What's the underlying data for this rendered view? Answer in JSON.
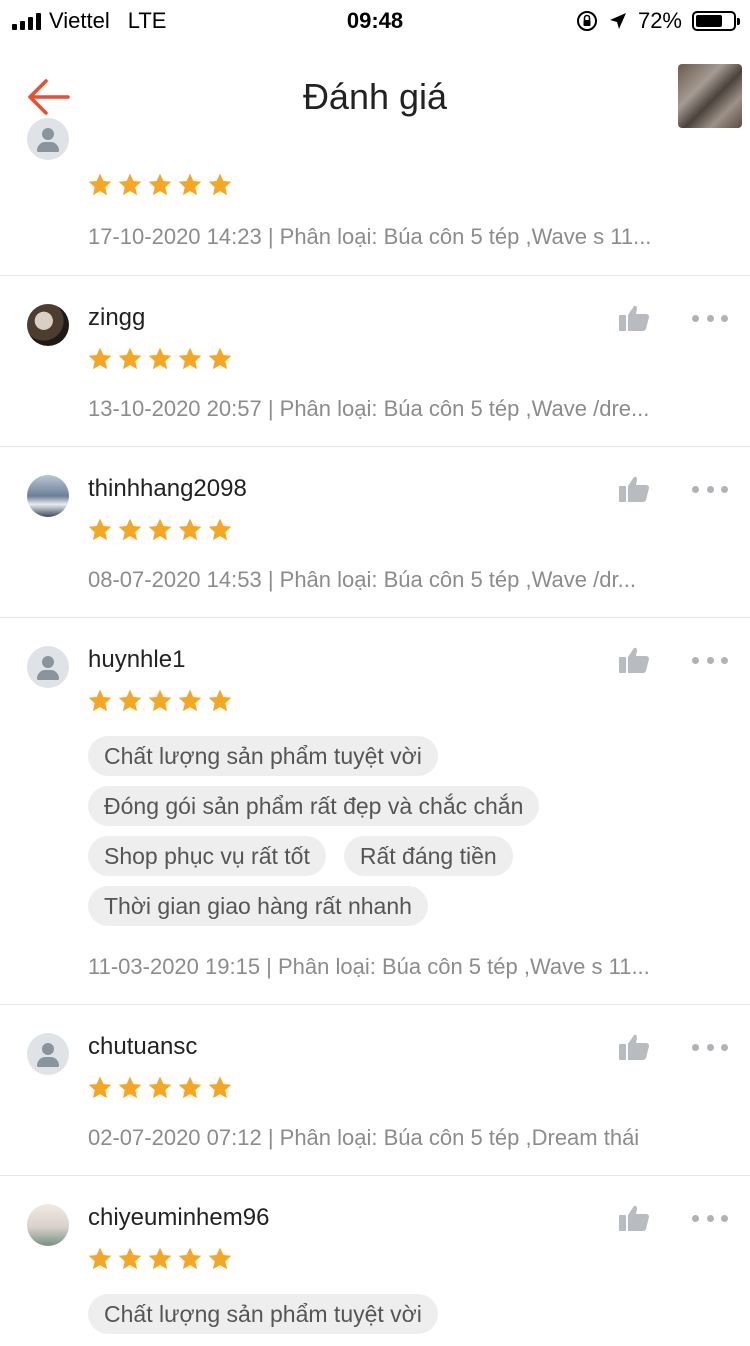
{
  "status_bar": {
    "carrier": "Viettel",
    "network": "LTE",
    "time": "09:48",
    "battery": "72%",
    "battery_level": 0.72
  },
  "header": {
    "title": "Đánh giá",
    "back_icon": "arrow-left-icon",
    "accent_color": "#ee4d2d"
  },
  "reviews": [
    {
      "username": "",
      "rating": 5,
      "meta": "17-10-2020 14:23 | Phân loại: Búa côn 5 tép ,Wave s 11...",
      "tags": []
    },
    {
      "username": "zingg",
      "rating": 5,
      "meta": "13-10-2020 20:57 | Phân loại: Búa côn 5 tép ,Wave /dre...",
      "tags": []
    },
    {
      "username": "thinhhang2098",
      "rating": 5,
      "meta": "08-07-2020 14:53 | Phân loại: Búa côn 5 tép ,Wave /dr...",
      "tags": []
    },
    {
      "username": "huynhle1",
      "rating": 5,
      "meta": "11-03-2020 19:15 | Phân loại: Búa côn 5 tép ,Wave s 11...",
      "tags": [
        "Chất lượng sản phẩm tuyệt vời",
        "Đóng gói sản phẩm rất đẹp và chắc chắn",
        "Shop phục vụ rất tốt",
        "Rất đáng tiền",
        "Thời gian giao hàng rất nhanh"
      ]
    },
    {
      "username": "chutuansc",
      "rating": 5,
      "meta": "02-07-2020 07:12 | Phân loại: Búa côn 5 tép ,Dream thái",
      "tags": []
    },
    {
      "username": "chiyeuminhem96",
      "rating": 5,
      "meta": "",
      "tags": [
        "Chất lượng sản phẩm tuyệt vời"
      ]
    }
  ],
  "colors": {
    "star": "#f5a623",
    "text_muted": "#8c8c8c",
    "tag_bg": "#eeeeee"
  }
}
